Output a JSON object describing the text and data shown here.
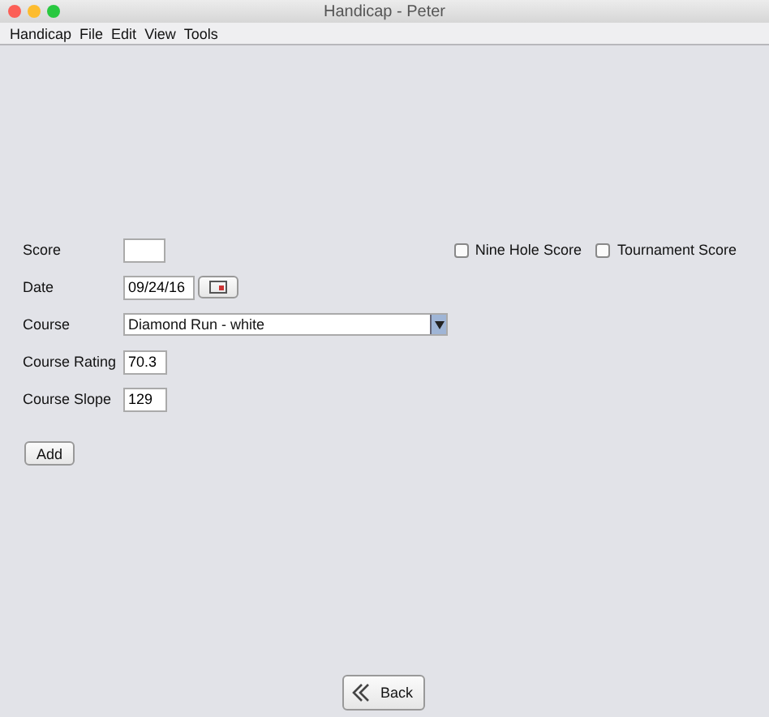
{
  "window": {
    "title": "Handicap - Peter"
  },
  "menu": [
    "Handicap",
    "File",
    "Edit",
    "View",
    "Tools"
  ],
  "fields": [
    {
      "kind": "text",
      "label": "Score"
    },
    {
      "kind": "date",
      "label": "Date",
      "value": "09/24/16"
    },
    {
      "kind": "combo",
      "label": "Course",
      "value": "Diamond Run - white"
    },
    {
      "kind": "text",
      "label": "Course Rating",
      "value": "70.3"
    },
    {
      "kind": "text",
      "label": "Course Slope",
      "value": "129"
    }
  ],
  "options": [
    {
      "label": "Nine Hole Score",
      "checked": false
    },
    {
      "label": "Tournament Score",
      "checked": false
    }
  ],
  "add_button": "Add",
  "back_button": "Back"
}
